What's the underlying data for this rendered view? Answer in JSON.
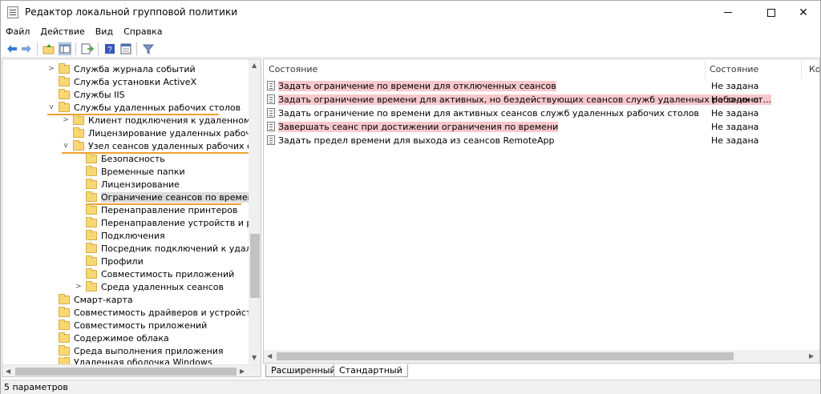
{
  "window": {
    "title": "Редактор локальной групповой политики",
    "minimize_glyph": "—",
    "maximize_glyph": "☐",
    "close_glyph": "✕"
  },
  "menu": {
    "items": [
      "Файл",
      "Действие",
      "Вид",
      "Справка"
    ]
  },
  "toolbar": {
    "icons": [
      "back-icon",
      "forward-icon",
      "up-folder-icon",
      "show-hide-tree-icon",
      "export-list-icon",
      "help-icon",
      "properties-icon",
      "filter-icon"
    ]
  },
  "tree": {
    "items": [
      {
        "label": "Служба журнала событий",
        "expander": ">"
      },
      {
        "label": "Служба установки ActiveX",
        "expander": ""
      },
      {
        "label": "Службы IIS",
        "expander": ""
      },
      {
        "label": "Службы удаленных рабочих столов",
        "expander": "v"
      },
      {
        "label": "Клиент подключения к удаленному рабо",
        "expander": ">"
      },
      {
        "label": "Лицензирование удаленных рабочих стс",
        "expander": ""
      },
      {
        "label": "Узел сеансов удаленных рабочих столов",
        "expander": "v"
      },
      {
        "label": "Безопасность",
        "expander": ""
      },
      {
        "label": "Временные папки",
        "expander": ""
      },
      {
        "label": "Лицензирование",
        "expander": ""
      },
      {
        "label": "Ограничение сеансов по времени",
        "expander": ""
      },
      {
        "label": "Перенаправление принтеров",
        "expander": ""
      },
      {
        "label": "Перенаправление устройств и ресур",
        "expander": ""
      },
      {
        "label": "Подключения",
        "expander": ""
      },
      {
        "label": "Посредник подключений к удаленно",
        "expander": ""
      },
      {
        "label": "Профили",
        "expander": ""
      },
      {
        "label": "Совместимость приложений",
        "expander": ""
      },
      {
        "label": "Среда удаленных сеансов",
        "expander": ">"
      },
      {
        "label": "Смарт-карта",
        "expander": ""
      },
      {
        "label": "Совместимость драйверов и устройств",
        "expander": ""
      },
      {
        "label": "Совместимость приложений",
        "expander": ""
      },
      {
        "label": "Содержимое облака",
        "expander": ""
      },
      {
        "label": "Среда выполнения приложения",
        "expander": ""
      },
      {
        "label": "Удаленная оболочка Windows",
        "expander": ""
      }
    ]
  },
  "list": {
    "columns": [
      "Состояние",
      "Состояние",
      "Ко"
    ],
    "rows": [
      {
        "name": "Задать ограничение по времени для отключенных сеансов",
        "state": "Не задана",
        "highlighted": true
      },
      {
        "name": "Задать ограничение времени для активных, но бездействующих сеансов служб удаленных рабочих ст...",
        "state": "Не задана",
        "highlighted": true
      },
      {
        "name": "Задать ограничение по времени для активных сеансов служб удаленных рабочих столов",
        "state": "Не задана",
        "highlighted": false
      },
      {
        "name": "Завершать сеанс при достижении ограничения по времени",
        "state": "Не задана",
        "highlighted": true
      },
      {
        "name": "Задать предел времени для выхода из сеансов RemoteApp",
        "state": "Не задана",
        "highlighted": false
      }
    ]
  },
  "tabs": [
    "Расширенный",
    "Стандартный"
  ],
  "status": {
    "text": "5 параметров"
  },
  "colors": {
    "highlight": "#f8c8cc",
    "underline": "#f0a030",
    "folder": "#f8d775"
  }
}
